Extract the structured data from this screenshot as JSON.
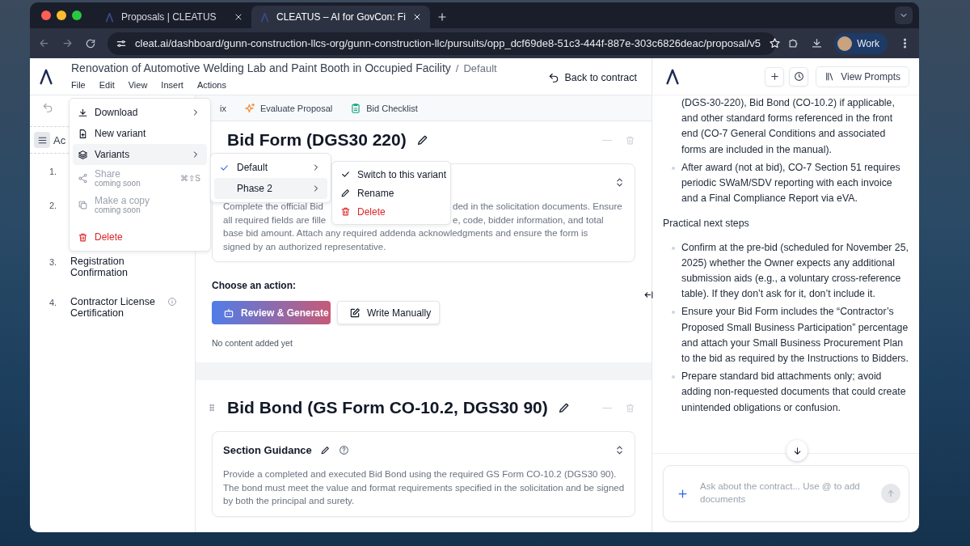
{
  "browser": {
    "tabs": [
      {
        "title": "Proposals | CLEATUS",
        "selected": false
      },
      {
        "title": "CLEATUS – AI for GovCon: Fi",
        "selected": true
      }
    ],
    "url": "cleat.ai/dashboard/gunn-construction-llcs-org/gunn-construction-llc/pursuits/opp_dcf69de8-51c3-444f-887e-303c6826deac/proposal/v5",
    "profile": "Work"
  },
  "header": {
    "title": "Renovation of Automotive Welding Lab and Paint Booth in Occupied Facility",
    "separator": "/",
    "variant": "Default",
    "menus": [
      "File",
      "Edit",
      "View",
      "Insert",
      "Actions"
    ],
    "back": "Back to contract"
  },
  "toolbar": {
    "items": [
      {
        "label": "ix",
        "kind": "partial"
      },
      {
        "label": "Evaluate Proposal",
        "kind": "evaluate"
      },
      {
        "label": "Bid Checklist",
        "kind": "checklist"
      }
    ]
  },
  "outline": {
    "header": "Ac",
    "items": [
      {
        "number": "1."
      },
      {
        "number": "2."
      },
      {
        "number": "3.",
        "label": "Registration Confirmation",
        "info": false
      },
      {
        "number": "4.",
        "label": "Contractor License Certification",
        "info": true
      }
    ]
  },
  "sections": [
    {
      "title": "Bid Form (DGS30 220)",
      "guidance_fragments": [
        [
          "Complete the official Bid",
          "ded in the solicitation documents. Ensure"
        ],
        [
          "all required fields are fille",
          "e, code, bidder information, and total"
        ],
        [
          "base bid amount. Attach any required addenda acknowledgments and ensure the form is"
        ],
        [
          "signed by an authorized representative."
        ]
      ],
      "prompt": "Choose an action:",
      "actions": [
        {
          "label": "Review & Generate",
          "kind": "primary"
        },
        {
          "label": "Write Manually",
          "kind": "secondary"
        }
      ],
      "empty_note": "No content added yet"
    },
    {
      "title": "Bid Bond (GS Form CO-10.2, DGS30 90)",
      "guidance_title": "Section Guidance",
      "guidance": "Provide a completed and executed Bid Bond using the required GS Form CO-10.2 (DGS30 90). The bond must meet the value and format requirements specified in the solicitation and be signed by both the principal and surety."
    }
  ],
  "chat": {
    "view_prompts": "View Prompts",
    "blocks": [
      {
        "kind": "continuation",
        "text": "(DGS-30-220), Bid Bond (CO-10.2) if applicable, and other standard forms referenced in the front end (CO-7 General Conditions and associated forms are included in the manual)."
      },
      {
        "kind": "bullet",
        "text": "After award (not at bid), CO-7 Section 51 requires periodic SWaM/SDV reporting with each invoice and a Final Compliance Report via eVA."
      },
      {
        "kind": "heading",
        "text": "Practical next steps"
      },
      {
        "kind": "bullet",
        "text": "Confirm at the pre-bid (scheduled for November 25, 2025) whether the Owner expects any additional submission aids (e.g., a voluntary cross-reference table). If they don’t ask for it, don’t include it."
      },
      {
        "kind": "bullet",
        "text": "Ensure your Bid Form includes the “Contractor’s Proposed Small Business Participation” percentage and attach your Small Business Procurement Plan to the bid as required by the Instructions to Bidders."
      },
      {
        "kind": "bullet",
        "text": "Prepare standard bid attachments only; avoid adding non-requested documents that could create unintended obligations or confusion."
      }
    ],
    "input": {
      "placeholder": "Ask about the contract... Use @ to add documents"
    }
  },
  "menu": {
    "items": [
      {
        "label": "Download",
        "kind": "download",
        "submenu": true,
        "disabled": false,
        "selected": false
      },
      {
        "label": "New variant",
        "kind": "new",
        "submenu": false,
        "disabled": false,
        "selected": false
      },
      {
        "label": "Variants",
        "kind": "variants",
        "submenu": true,
        "disabled": false,
        "selected": true
      },
      {
        "label": "Share",
        "sublabel": "coming soon",
        "shortcut": "⌘⇧S",
        "kind": "share",
        "submenu": false,
        "disabled": true,
        "selected": false
      },
      {
        "label": "Make a copy",
        "sublabel": "coming soon",
        "kind": "copy",
        "submenu": false,
        "disabled": true,
        "selected": false
      },
      {
        "label": "Delete",
        "kind": "delete",
        "submenu": false,
        "disabled": false,
        "selected": false
      }
    ],
    "variants": [
      {
        "label": "Default",
        "checked": true,
        "selected": false
      },
      {
        "label": "Phase 2",
        "checked": false,
        "selected": true
      }
    ],
    "variant_actions": [
      {
        "label": "Switch to this variant",
        "kind": "switch"
      },
      {
        "label": "Rename",
        "kind": "rename"
      },
      {
        "label": "Delete",
        "kind": "delete"
      }
    ]
  }
}
